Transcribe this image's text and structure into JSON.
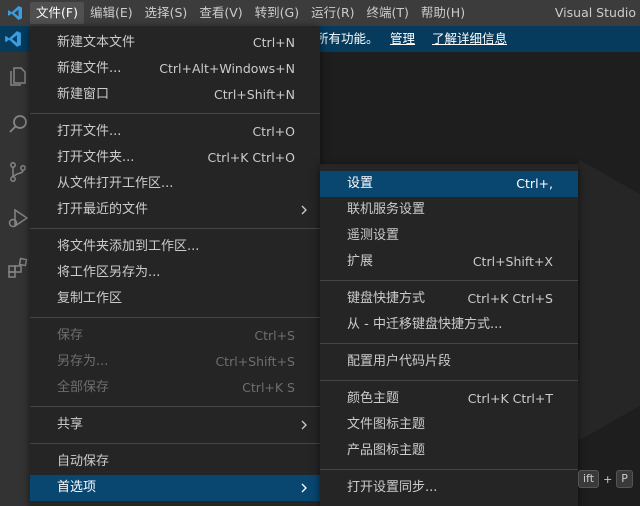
{
  "colors": {
    "accent": "#0078d4",
    "banner_bg": "#063b5e",
    "menu_bg": "#252526",
    "selection": "#094771"
  },
  "titlebar": {
    "menus": [
      "文件(F)",
      "编辑(E)",
      "选择(S)",
      "查看(V)",
      "转到(G)",
      "运行(R)",
      "终端(T)",
      "帮助(H)"
    ],
    "window_title": "Visual Studio"
  },
  "banner": {
    "text": "所有功能。",
    "link_manage": "管理",
    "link_learn_more": "了解详细信息"
  },
  "activity_icons": [
    "explorer-icon",
    "search-icon",
    "source-control-icon",
    "run-debug-icon",
    "extensions-icon"
  ],
  "file_menu": {
    "items": [
      {
        "label": "新建文本文件",
        "kb": "Ctrl+N"
      },
      {
        "label": "新建文件...",
        "kb": "Ctrl+Alt+Windows+N"
      },
      {
        "label": "新建窗口",
        "kb": "Ctrl+Shift+N"
      },
      {
        "label": "打开文件...",
        "kb": "Ctrl+O"
      },
      {
        "label": "打开文件夹...",
        "kb": "Ctrl+K Ctrl+O"
      },
      {
        "label": "从文件打开工作区...",
        "kb": ""
      },
      {
        "label": "打开最近的文件",
        "kb": ""
      },
      {
        "label": "将文件夹添加到工作区...",
        "kb": ""
      },
      {
        "label": "将工作区另存为...",
        "kb": ""
      },
      {
        "label": "复制工作区",
        "kb": ""
      },
      {
        "label": "保存",
        "kb": "Ctrl+S"
      },
      {
        "label": "另存为...",
        "kb": "Ctrl+Shift+S"
      },
      {
        "label": "全部保存",
        "kb": "Ctrl+K S"
      },
      {
        "label": "共享",
        "kb": ""
      },
      {
        "label": "自动保存",
        "kb": ""
      },
      {
        "label": "首选项",
        "kb": ""
      }
    ]
  },
  "pref_menu": {
    "items": [
      {
        "label": "设置",
        "kb": "Ctrl+,"
      },
      {
        "label": "联机服务设置",
        "kb": ""
      },
      {
        "label": "遥测设置",
        "kb": ""
      },
      {
        "label": "扩展",
        "kb": "Ctrl+Shift+X"
      },
      {
        "label": "键盘快捷方式",
        "kb": "Ctrl+K Ctrl+S"
      },
      {
        "label": "从 - 中迁移键盘快捷方式...",
        "kb": ""
      },
      {
        "label": "配置用户代码片段",
        "kb": ""
      },
      {
        "label": "颜色主题",
        "kb": "Ctrl+K Ctrl+T"
      },
      {
        "label": "文件图标主题",
        "kb": ""
      },
      {
        "label": "产品图标主题",
        "kb": ""
      },
      {
        "label": "打开设置同步...",
        "kb": ""
      }
    ]
  },
  "hint": {
    "key1": "ift",
    "plus": "+",
    "key2": "P"
  }
}
